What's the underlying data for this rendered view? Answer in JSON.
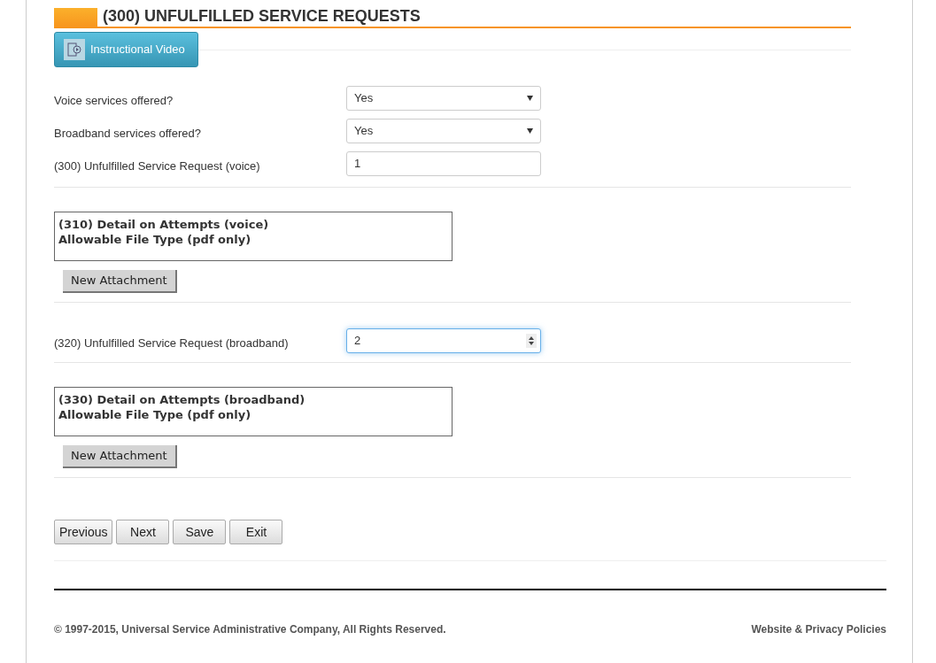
{
  "header": {
    "title": "(300) UNFULFILLED SERVICE REQUESTS",
    "video_button": "Instructional Video"
  },
  "sections": [
    {
      "kind": "fields",
      "rows": [
        {
          "kind": "select",
          "label": "Voice services offered?",
          "value": "Yes",
          "focused": false
        },
        {
          "kind": "select",
          "label": "Broadband services offered?",
          "value": "Yes",
          "focused": false
        },
        {
          "kind": "text",
          "label": "(300) Unfulfilled Service Request (voice)",
          "value": "1",
          "focused": false
        }
      ]
    },
    {
      "kind": "attachment",
      "title": "(310) Detail on Attempts (voice)",
      "note": "Allowable File Type (pdf only)",
      "button": "New Attachment"
    },
    {
      "kind": "fields",
      "rows": [
        {
          "kind": "number",
          "label": "(320) Unfulfilled Service Request (broadband)",
          "value": "2",
          "focused": true
        }
      ]
    },
    {
      "kind": "attachment",
      "title": "(330) Detail on Attempts (broadband)",
      "note": "Allowable File Type (pdf only)",
      "button": "New Attachment"
    }
  ],
  "nav_buttons": [
    "Previous",
    "Next",
    "Save",
    "Exit"
  ],
  "footer": {
    "copyright": "© 1997-2015, Universal Service Administrative Company, All Rights Reserved.",
    "link": "Website & Privacy Policies"
  }
}
